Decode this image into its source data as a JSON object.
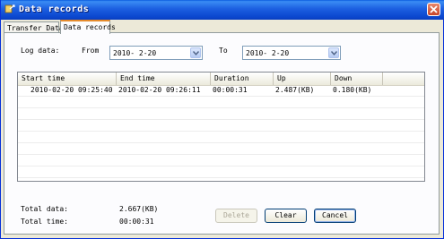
{
  "window": {
    "title": "Data records",
    "app_icon": "data-records-icon",
    "close_icon": "close-icon"
  },
  "tabs": [
    {
      "label": "Transfer Data",
      "selected": false
    },
    {
      "label": "Data records",
      "selected": true
    }
  ],
  "filter": {
    "log_label": "Log data:",
    "from_label": "From",
    "from_value": "2010- 2-20",
    "to_label": "To",
    "to_value": "2010- 2-20"
  },
  "table": {
    "columns": [
      "Start time",
      "End time",
      "Duration",
      "Up",
      "Down"
    ],
    "rows": [
      [
        "2010-02-20 09:25:40",
        "2010-02-20 09:26:11",
        "00:00:31",
        "2.487(KB)",
        "0.180(KB)"
      ]
    ]
  },
  "summary": {
    "total_data_label": "Total data:",
    "total_data_value": "2.667(KB)",
    "total_time_label": "Total time:",
    "total_time_value": "00:00:31"
  },
  "buttons": {
    "delete": "Delete",
    "clear": "Clear",
    "cancel": "Cancel"
  },
  "colors": {
    "title_bar": "#0b47cf",
    "tab_highlight": "#e68b2c",
    "dialog_bg": "#ece9d8"
  }
}
